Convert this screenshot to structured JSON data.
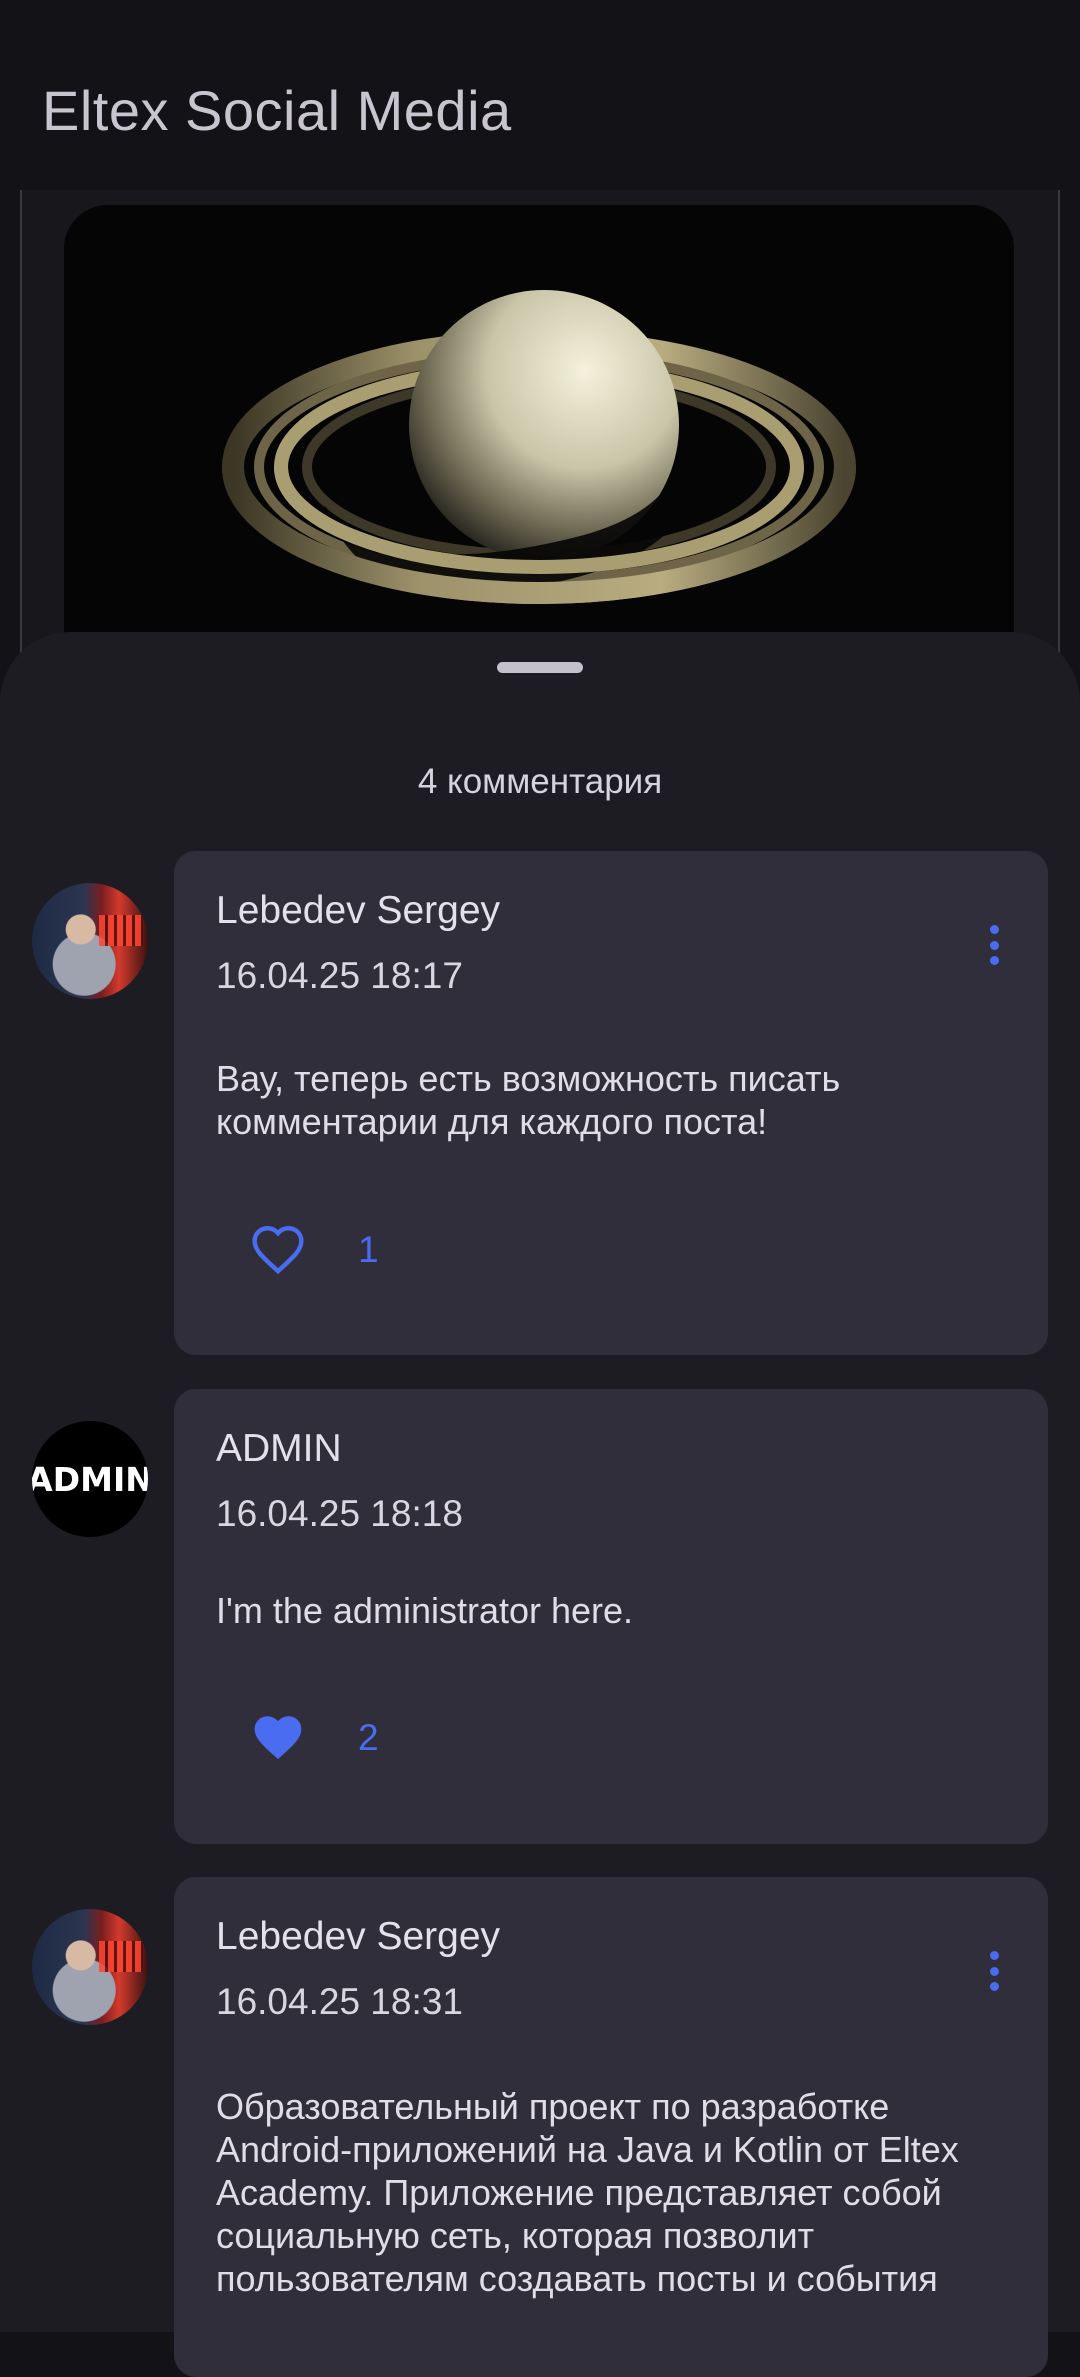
{
  "app": {
    "title": "Eltex Social Media"
  },
  "comments_header": {
    "count_label": "4 комментария"
  },
  "comments": [
    {
      "author": "Lebedev Sergey",
      "date": "16.04.25 18:17",
      "text": "Вау, теперь есть возможность писать комментарии для каждого поста!",
      "likes": "1",
      "liked": false
    },
    {
      "author": "ADMIN",
      "avatar_text": "ADMIN",
      "date": "16.04.25 18:18",
      "text": "I'm the administrator here.",
      "likes": "2",
      "liked": true
    },
    {
      "author": "Lebedev Sergey",
      "date": "16.04.25 18:31",
      "text": "Образовательный проект по разработке Android-приложений на Java и Kotlin от Eltex Academy. Приложение представляет собой социальную сеть, которая позволит пользователям создавать посты и события"
    }
  ],
  "icons": {
    "like": "heart-icon",
    "menu": "more-vert-icon"
  },
  "colors": {
    "background": "#131217",
    "sheet": "#1d1c22",
    "card": "#312e3b",
    "accent": "#4a6cf0"
  }
}
